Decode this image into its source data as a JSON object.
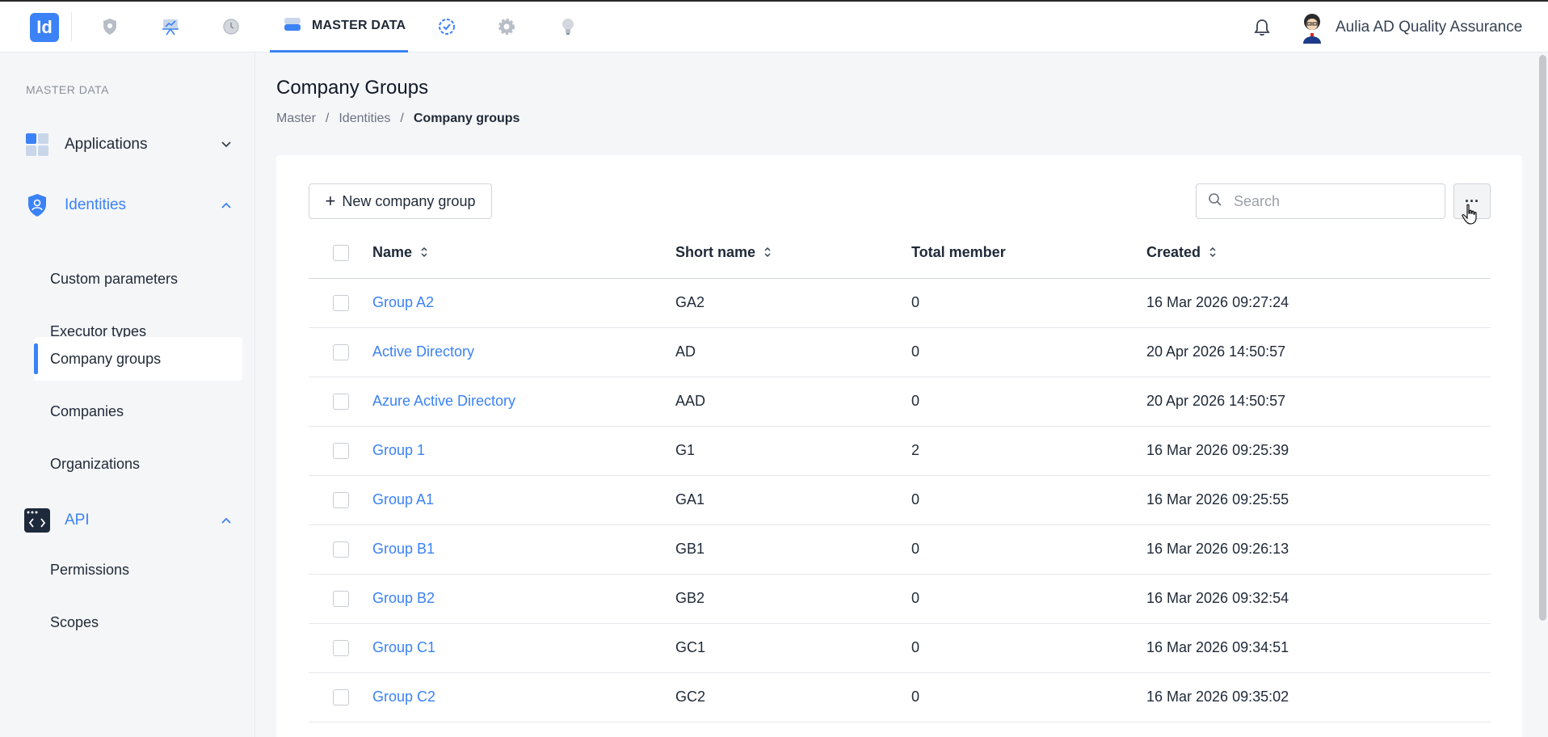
{
  "topbar": {
    "logo_text": "Id",
    "active_tab_label": "MASTER DATA",
    "user_name": "Aulia AD Quality Assurance",
    "nav_icons": [
      "shield-icon",
      "presentation-icon",
      "clock-icon",
      "database-icon",
      "check-badge-icon",
      "gear-icon",
      "lightbulb-icon"
    ]
  },
  "sidebar": {
    "heading": "MASTER DATA",
    "groups": [
      {
        "label": "Applications",
        "icon": "apps-grid-icon",
        "expanded": false
      },
      {
        "label": "Identities",
        "icon": "shield-user-icon",
        "expanded": true
      },
      {
        "label": "API",
        "icon": "code-window-icon",
        "expanded": true
      }
    ],
    "identities_items": [
      "Custom parameters",
      "Executor types",
      "Company groups",
      "Companies",
      "Organizations"
    ],
    "api_items": [
      "Permissions",
      "Scopes"
    ],
    "active_item": "Company groups"
  },
  "main": {
    "title": "Company Groups",
    "breadcrumb": [
      "Master",
      "Identities",
      "Company groups"
    ],
    "new_button_label": "New company group",
    "search_placeholder": "Search",
    "more_label": "···",
    "columns": [
      "Name",
      "Short name",
      "Total member",
      "Created"
    ],
    "rows": [
      {
        "name": "Group A2",
        "short": "GA2",
        "total": "0",
        "created": "16 Mar 2026 09:27:24"
      },
      {
        "name": "Active Directory",
        "short": "AD",
        "total": "0",
        "created": "20 Apr 2026 14:50:57"
      },
      {
        "name": "Azure Active Directory",
        "short": "AAD",
        "total": "0",
        "created": "20 Apr 2026 14:50:57"
      },
      {
        "name": "Group 1",
        "short": "G1",
        "total": "2",
        "created": "16 Mar 2026 09:25:39"
      },
      {
        "name": "Group A1",
        "short": "GA1",
        "total": "0",
        "created": "16 Mar 2026 09:25:55"
      },
      {
        "name": "Group B1",
        "short": "GB1",
        "total": "0",
        "created": "16 Mar 2026 09:26:13"
      },
      {
        "name": "Group B2",
        "short": "GB2",
        "total": "0",
        "created": "16 Mar 2026 09:32:54"
      },
      {
        "name": "Group C1",
        "short": "GC1",
        "total": "0",
        "created": "16 Mar 2026 09:34:51"
      },
      {
        "name": "Group C2",
        "short": "GC2",
        "total": "0",
        "created": "16 Mar 2026 09:35:02"
      }
    ]
  },
  "colors": {
    "accent": "#3b82f6",
    "sidebar_bg": "#f5f6f8"
  }
}
